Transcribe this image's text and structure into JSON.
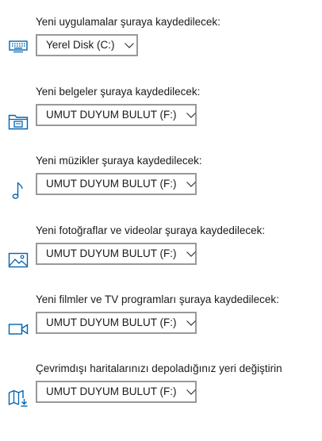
{
  "accent_color": "#0063b1",
  "rows": [
    {
      "label": "Yeni uygulamalar şuraya kaydedilecek:",
      "icon": "keyboard-icon",
      "value": "Yerel Disk (C:)"
    },
    {
      "label": "Yeni belgeler şuraya kaydedilecek:",
      "icon": "documents-folder-icon",
      "value": "UMUT DUYUM BULUT (F:)"
    },
    {
      "label": "Yeni müzikler şuraya kaydedilecek:",
      "icon": "music-note-icon",
      "value": "UMUT DUYUM BULUT (F:)"
    },
    {
      "label": "Yeni fotoğraflar ve videolar şuraya kaydedilecek:",
      "icon": "picture-icon",
      "value": "UMUT DUYUM BULUT (F:)"
    },
    {
      "label": "Yeni filmler ve TV programları şuraya kaydedilecek:",
      "icon": "video-camera-icon",
      "value": "UMUT DUYUM BULUT (F:)"
    },
    {
      "label": "Çevrimdışı haritalarınızı depoladığınız yeri değiştirin",
      "icon": "offline-map-icon",
      "value": "UMUT DUYUM BULUT (F:)"
    }
  ]
}
